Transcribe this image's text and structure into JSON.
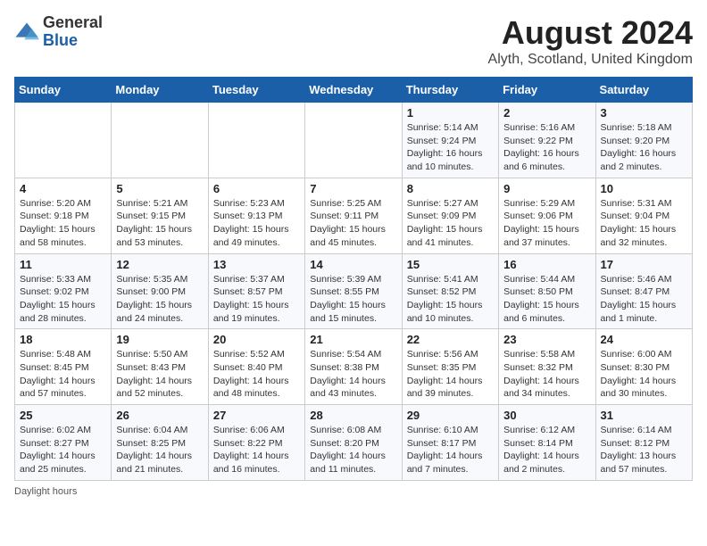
{
  "logo": {
    "general": "General",
    "blue": "Blue"
  },
  "title": "August 2024",
  "subtitle": "Alyth, Scotland, United Kingdom",
  "days_of_week": [
    "Sunday",
    "Monday",
    "Tuesday",
    "Wednesday",
    "Thursday",
    "Friday",
    "Saturday"
  ],
  "footer_note": "Daylight hours",
  "weeks": [
    [
      {
        "day": "",
        "sunrise": "",
        "sunset": "",
        "daylight": ""
      },
      {
        "day": "",
        "sunrise": "",
        "sunset": "",
        "daylight": ""
      },
      {
        "day": "",
        "sunrise": "",
        "sunset": "",
        "daylight": ""
      },
      {
        "day": "",
        "sunrise": "",
        "sunset": "",
        "daylight": ""
      },
      {
        "day": "1",
        "sunrise": "Sunrise: 5:14 AM",
        "sunset": "Sunset: 9:24 PM",
        "daylight": "Daylight: 16 hours and 10 minutes."
      },
      {
        "day": "2",
        "sunrise": "Sunrise: 5:16 AM",
        "sunset": "Sunset: 9:22 PM",
        "daylight": "Daylight: 16 hours and 6 minutes."
      },
      {
        "day": "3",
        "sunrise": "Sunrise: 5:18 AM",
        "sunset": "Sunset: 9:20 PM",
        "daylight": "Daylight: 16 hours and 2 minutes."
      }
    ],
    [
      {
        "day": "4",
        "sunrise": "Sunrise: 5:20 AM",
        "sunset": "Sunset: 9:18 PM",
        "daylight": "Daylight: 15 hours and 58 minutes."
      },
      {
        "day": "5",
        "sunrise": "Sunrise: 5:21 AM",
        "sunset": "Sunset: 9:15 PM",
        "daylight": "Daylight: 15 hours and 53 minutes."
      },
      {
        "day": "6",
        "sunrise": "Sunrise: 5:23 AM",
        "sunset": "Sunset: 9:13 PM",
        "daylight": "Daylight: 15 hours and 49 minutes."
      },
      {
        "day": "7",
        "sunrise": "Sunrise: 5:25 AM",
        "sunset": "Sunset: 9:11 PM",
        "daylight": "Daylight: 15 hours and 45 minutes."
      },
      {
        "day": "8",
        "sunrise": "Sunrise: 5:27 AM",
        "sunset": "Sunset: 9:09 PM",
        "daylight": "Daylight: 15 hours and 41 minutes."
      },
      {
        "day": "9",
        "sunrise": "Sunrise: 5:29 AM",
        "sunset": "Sunset: 9:06 PM",
        "daylight": "Daylight: 15 hours and 37 minutes."
      },
      {
        "day": "10",
        "sunrise": "Sunrise: 5:31 AM",
        "sunset": "Sunset: 9:04 PM",
        "daylight": "Daylight: 15 hours and 32 minutes."
      }
    ],
    [
      {
        "day": "11",
        "sunrise": "Sunrise: 5:33 AM",
        "sunset": "Sunset: 9:02 PM",
        "daylight": "Daylight: 15 hours and 28 minutes."
      },
      {
        "day": "12",
        "sunrise": "Sunrise: 5:35 AM",
        "sunset": "Sunset: 9:00 PM",
        "daylight": "Daylight: 15 hours and 24 minutes."
      },
      {
        "day": "13",
        "sunrise": "Sunrise: 5:37 AM",
        "sunset": "Sunset: 8:57 PM",
        "daylight": "Daylight: 15 hours and 19 minutes."
      },
      {
        "day": "14",
        "sunrise": "Sunrise: 5:39 AM",
        "sunset": "Sunset: 8:55 PM",
        "daylight": "Daylight: 15 hours and 15 minutes."
      },
      {
        "day": "15",
        "sunrise": "Sunrise: 5:41 AM",
        "sunset": "Sunset: 8:52 PM",
        "daylight": "Daylight: 15 hours and 10 minutes."
      },
      {
        "day": "16",
        "sunrise": "Sunrise: 5:44 AM",
        "sunset": "Sunset: 8:50 PM",
        "daylight": "Daylight: 15 hours and 6 minutes."
      },
      {
        "day": "17",
        "sunrise": "Sunrise: 5:46 AM",
        "sunset": "Sunset: 8:47 PM",
        "daylight": "Daylight: 15 hours and 1 minute."
      }
    ],
    [
      {
        "day": "18",
        "sunrise": "Sunrise: 5:48 AM",
        "sunset": "Sunset: 8:45 PM",
        "daylight": "Daylight: 14 hours and 57 minutes."
      },
      {
        "day": "19",
        "sunrise": "Sunrise: 5:50 AM",
        "sunset": "Sunset: 8:43 PM",
        "daylight": "Daylight: 14 hours and 52 minutes."
      },
      {
        "day": "20",
        "sunrise": "Sunrise: 5:52 AM",
        "sunset": "Sunset: 8:40 PM",
        "daylight": "Daylight: 14 hours and 48 minutes."
      },
      {
        "day": "21",
        "sunrise": "Sunrise: 5:54 AM",
        "sunset": "Sunset: 8:38 PM",
        "daylight": "Daylight: 14 hours and 43 minutes."
      },
      {
        "day": "22",
        "sunrise": "Sunrise: 5:56 AM",
        "sunset": "Sunset: 8:35 PM",
        "daylight": "Daylight: 14 hours and 39 minutes."
      },
      {
        "day": "23",
        "sunrise": "Sunrise: 5:58 AM",
        "sunset": "Sunset: 8:32 PM",
        "daylight": "Daylight: 14 hours and 34 minutes."
      },
      {
        "day": "24",
        "sunrise": "Sunrise: 6:00 AM",
        "sunset": "Sunset: 8:30 PM",
        "daylight": "Daylight: 14 hours and 30 minutes."
      }
    ],
    [
      {
        "day": "25",
        "sunrise": "Sunrise: 6:02 AM",
        "sunset": "Sunset: 8:27 PM",
        "daylight": "Daylight: 14 hours and 25 minutes."
      },
      {
        "day": "26",
        "sunrise": "Sunrise: 6:04 AM",
        "sunset": "Sunset: 8:25 PM",
        "daylight": "Daylight: 14 hours and 21 minutes."
      },
      {
        "day": "27",
        "sunrise": "Sunrise: 6:06 AM",
        "sunset": "Sunset: 8:22 PM",
        "daylight": "Daylight: 14 hours and 16 minutes."
      },
      {
        "day": "28",
        "sunrise": "Sunrise: 6:08 AM",
        "sunset": "Sunset: 8:20 PM",
        "daylight": "Daylight: 14 hours and 11 minutes."
      },
      {
        "day": "29",
        "sunrise": "Sunrise: 6:10 AM",
        "sunset": "Sunset: 8:17 PM",
        "daylight": "Daylight: 14 hours and 7 minutes."
      },
      {
        "day": "30",
        "sunrise": "Sunrise: 6:12 AM",
        "sunset": "Sunset: 8:14 PM",
        "daylight": "Daylight: 14 hours and 2 minutes."
      },
      {
        "day": "31",
        "sunrise": "Sunrise: 6:14 AM",
        "sunset": "Sunset: 8:12 PM",
        "daylight": "Daylight: 13 hours and 57 minutes."
      }
    ]
  ]
}
